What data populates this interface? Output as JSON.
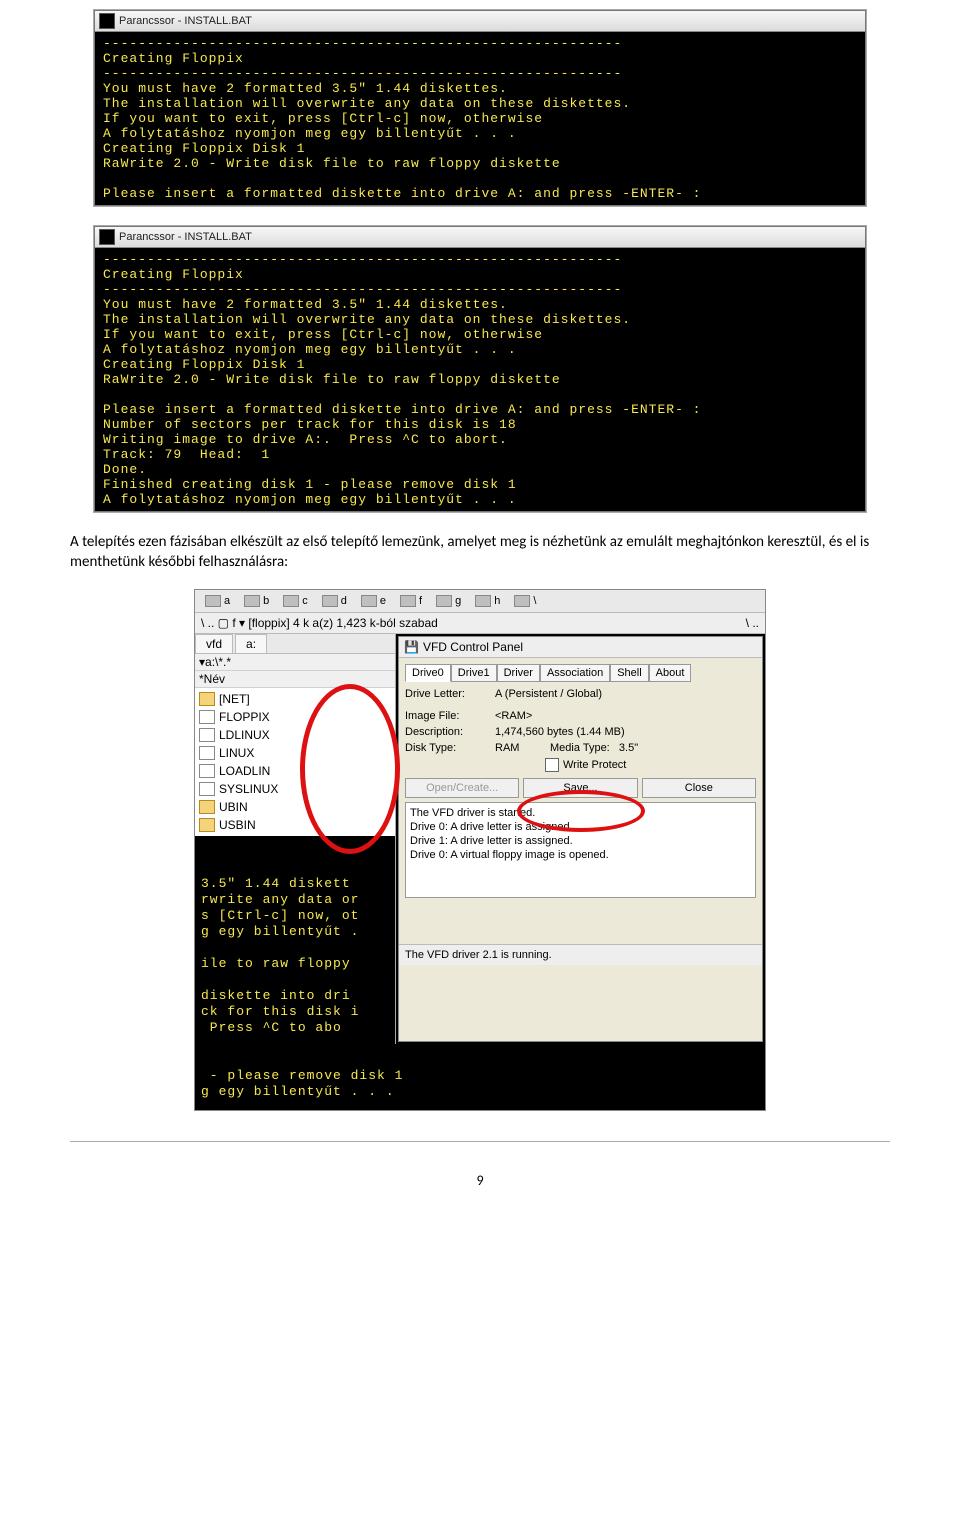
{
  "term1": {
    "title": "Parancssor - INSTALL.BAT",
    "lines": [
      "-----------------------------------------------------------",
      "Creating Floppix",
      "-----------------------------------------------------------",
      "You must have 2 formatted 3.5\" 1.44 diskettes.",
      "The installation will overwrite any data on these diskettes.",
      "If you want to exit, press [Ctrl-c] now, otherwise",
      "A folytatáshoz nyomjon meg egy billentyűt . . .",
      "Creating Floppix Disk 1",
      "RaWrite 2.0 - Write disk file to raw floppy diskette",
      "",
      "Please insert a formatted diskette into drive A: and press -ENTER- :"
    ]
  },
  "term2": {
    "title": "Parancssor - INSTALL.BAT",
    "lines": [
      "-----------------------------------------------------------",
      "Creating Floppix",
      "-----------------------------------------------------------",
      "You must have 2 formatted 3.5\" 1.44 diskettes.",
      "The installation will overwrite any data on these diskettes.",
      "If you want to exit, press [Ctrl-c] now, otherwise",
      "A folytatáshoz nyomjon meg egy billentyűt . . .",
      "Creating Floppix Disk 1",
      "RaWrite 2.0 - Write disk file to raw floppy diskette",
      "",
      "Please insert a formatted diskette into drive A: and press -ENTER- :",
      "Number of sectors per track for this disk is 18",
      "Writing image to drive A:.  Press ^C to abort.",
      "Track: 79  Head:  1",
      "Done.",
      "Finished creating disk 1 - please remove disk 1",
      "A folytatáshoz nyomjon meg egy billentyűt . . ."
    ]
  },
  "paragraph": "A telepítés ezen fázisában elkészült az első telepítő lemezünk, amelyet meg is nézhetünk az emulált meghajtónkon keresztül, és el is menthetünk későbbi felhasználásra:",
  "fm": {
    "drives": [
      "a",
      "b",
      "c",
      "d",
      "e",
      "f",
      "g",
      "h",
      "\\"
    ],
    "path_left": "\\  ..   ▢ f  ▾  [floppix]  4 k a(z) 1,423 k-ból szabad",
    "path_right": "\\   ..",
    "tab_left": "vfd",
    "tab_right": "a:",
    "col_name": "▾a:\\*.*",
    "col2": "*Név",
    "files": [
      {
        "type": "folder",
        "name": "[NET]"
      },
      {
        "type": "file",
        "name": "FLOPPIX"
      },
      {
        "type": "file",
        "name": "LDLINUX"
      },
      {
        "type": "file",
        "name": "LINUX"
      },
      {
        "type": "file",
        "name": "LOADLIN"
      },
      {
        "type": "file",
        "name": "SYSLINUX"
      },
      {
        "type": "folder",
        "name": "UBIN"
      },
      {
        "type": "folder",
        "name": "USBIN"
      }
    ]
  },
  "vfd": {
    "title": "VFD Control Panel",
    "tabs": [
      "Drive0",
      "Drive1",
      "Driver",
      "Association",
      "Shell",
      "About"
    ],
    "active_tab": 0,
    "fields": {
      "drive_letter_lbl": "Drive Letter:",
      "drive_letter_val": "A (Persistent / Global)",
      "image_file_lbl": "Image File:",
      "image_file_val": "<RAM>",
      "description_lbl": "Description:",
      "description_val": "1,474,560 bytes (1.44 MB)",
      "disk_type_lbl": "Disk Type:",
      "disk_type_val": "RAM",
      "media_type_lbl": "Media Type:",
      "media_type_val": "3.5\""
    },
    "write_protect": "Write Protect",
    "btn_open": "Open/Create...",
    "btn_save": "Save...",
    "btn_close": "Close",
    "log": [
      "The VFD driver is started.",
      "Drive 0: A drive letter is assigned.",
      "Drive 1: A drive letter is assigned.",
      "Drive 0: A virtual floppy image is opened."
    ],
    "status": "The VFD driver 2.1 is running."
  },
  "term3_left": [
    "",
    "",
    "3.5\" 1.44 diskett",
    "rwrite any data or",
    "s [Ctrl-c] now, ot",
    "g egy billentyűt .",
    "",
    "ile to raw floppy",
    "",
    "diskette into dri",
    "ck for this disk i",
    " Press ^C to abo"
  ],
  "term3_bottom": [
    " - please remove disk 1",
    "g egy billentyűt . . ."
  ],
  "page_number": "9"
}
